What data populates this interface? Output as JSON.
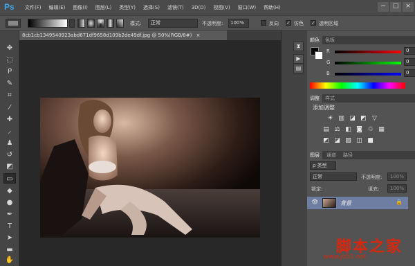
{
  "app": {
    "logo": "Ps",
    "menus": [
      "文件(F)",
      "编辑(E)",
      "图像(I)",
      "图层(L)",
      "类型(Y)",
      "选择(S)",
      "滤镜(T)",
      "3D(D)",
      "视图(V)",
      "窗口(W)",
      "帮助(H)"
    ],
    "window_buttons": [
      "−",
      "□",
      "×"
    ]
  },
  "options_bar": {
    "mode_label": "模式:",
    "mode_value": "正常",
    "opacity_label": "不透明度:",
    "opacity_value": "100%",
    "reverse_label": "反向",
    "dither_label": "仿色",
    "transparency_label": "透明区域"
  },
  "document": {
    "tab_title": "8cb1cb1349540923abd671df9658d109b2de49df.jpg @ 50%(RGB/8#)",
    "close_glyph": "×"
  },
  "color_panel": {
    "tabs": [
      "颜色",
      "色板"
    ],
    "channels": [
      {
        "label": "R",
        "value": "0"
      },
      {
        "label": "G",
        "value": "0"
      },
      {
        "label": "B",
        "value": "0"
      }
    ]
  },
  "adjustments_panel": {
    "tabs": [
      "调整",
      "样式"
    ],
    "title": "添加调整",
    "row1_icons": [
      "☀",
      "▥",
      "◪",
      "◩",
      "▽"
    ],
    "row2_icons": [
      "▤",
      "⚖",
      "◧",
      "◙",
      "♲",
      "▦"
    ],
    "row3_icons": [
      "◩",
      "◪",
      "▧",
      "◫",
      "■"
    ]
  },
  "layers_panel": {
    "tabs": [
      "图层",
      "通道",
      "路径"
    ],
    "filter_label": "ρ 类型",
    "blend_mode": "正常",
    "opacity_label": "不透明度:",
    "opacity_value": "100%",
    "lock_label": "锁定:",
    "fill_label": "填充:",
    "fill_value": "100%",
    "layer_name": "背景"
  },
  "watermark": {
    "line1": "脚本之家",
    "line2": "www.jb51.net"
  },
  "colors": {
    "accent": "#3da7f3",
    "layer_selected": "#6d7ea2",
    "watermark": "#d9270e"
  }
}
